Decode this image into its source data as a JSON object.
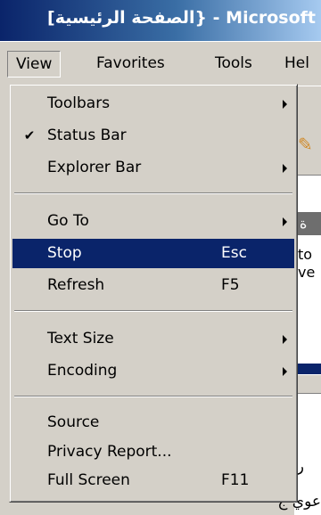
{
  "window": {
    "title": "[الصفحة الرئيسية} - Microsoft"
  },
  "menubar": {
    "items": [
      {
        "label": "View"
      },
      {
        "label": "Favorites"
      },
      {
        "label": "Tools"
      },
      {
        "label": "Hel"
      }
    ]
  },
  "view_menu": {
    "toolbars": {
      "label": "Toolbars"
    },
    "status_bar": {
      "label": "Status Bar",
      "checked": true,
      "check_glyph": "✔"
    },
    "explorer_bar": {
      "label": "Explorer Bar"
    },
    "go_to": {
      "label": "Go To"
    },
    "stop": {
      "label": "Stop",
      "shortcut": "Esc"
    },
    "refresh": {
      "label": "Refresh",
      "shortcut": "F5"
    },
    "text_size": {
      "label": "Text Size"
    },
    "encoding": {
      "label": "Encoding"
    },
    "source": {
      "label": "Source"
    },
    "privacy_report": {
      "label": "Privacy Report..."
    },
    "full_screen": {
      "label": "Full Screen",
      "shortcut": "F11"
    }
  },
  "background": {
    "dark_bar_text": "ة",
    "content_line1": "to",
    "content_line2": "ve",
    "rtl_text": "رأ",
    "bottom_text": "عوي ج"
  },
  "colors": {
    "highlight": "#0a246a",
    "menu_bg": "#d4d0c8",
    "title_gradient_start": "#0a246a",
    "title_gradient_end": "#a6caf0"
  }
}
